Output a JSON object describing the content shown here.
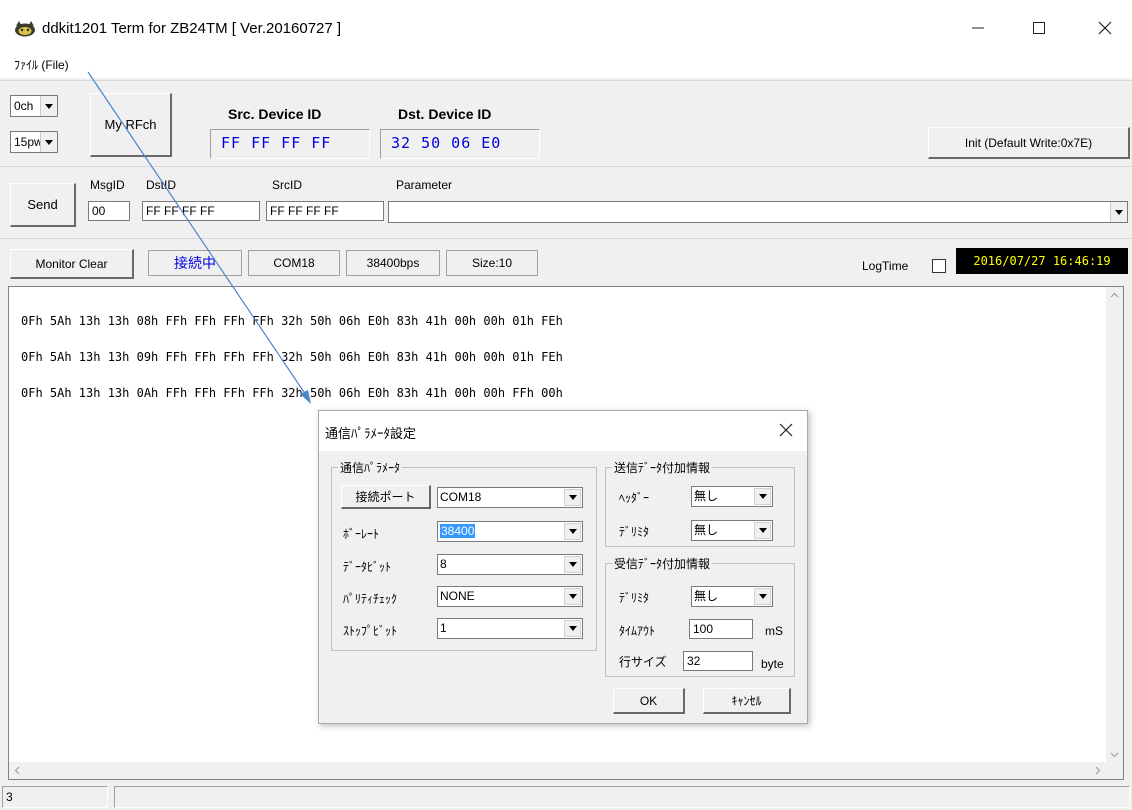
{
  "window": {
    "title": "ddkit1201 Term for ZB24TM  [ Ver.20160727 ]",
    "menu_file": "ﾌｧｲﾙ (File)"
  },
  "top_panel": {
    "channel": "0ch",
    "power": "15pw",
    "my_rfch_label": "My RFch",
    "src_label": "Src. Device ID",
    "dst_label": "Dst. Device ID",
    "src_value": "FF FF FF FF",
    "dst_value": "32 50 06 E0",
    "init_label": "Init (Default Write:0x7E)"
  },
  "send_panel": {
    "send_label": "Send",
    "msgid_label": "MsgID",
    "dstid_label": "DstID",
    "srcid_label": "SrcID",
    "param_label": "Parameter",
    "msgid_value": "00",
    "dstid_value": "FF FF FF FF",
    "srcid_value": "FF FF FF FF",
    "param_value": ""
  },
  "status_panel": {
    "monitor_clear": "Monitor Clear",
    "connected": "接続中",
    "com": "COM18",
    "bps": "38400bps",
    "size": "Size:10",
    "logtime_label": "LogTime",
    "datetime": "2016/07/27 16:46:19"
  },
  "monitor": {
    "lines": [
      "0Fh 5Ah 13h 13h 08h FFh FFh FFh FFh 32h 50h 06h E0h 83h 41h 00h 00h 01h FEh",
      "0Fh 5Ah 13h 13h 09h FFh FFh FFh FFh 32h 50h 06h E0h 83h 41h 00h 00h 01h FEh",
      "0Fh 5Ah 13h 13h 0Ah FFh FFh FFh FFh 32h 50h 06h E0h 83h 41h 00h 00h FFh 00h"
    ]
  },
  "statusbar": {
    "cell1": "3"
  },
  "dialog": {
    "title": "通信ﾊﾟﾗﾒｰﾀ設定",
    "comm_group": "通信ﾊﾟﾗﾒｰﾀ",
    "port_button": "接続ポート",
    "port_value": "COM18",
    "baud_label": "ﾎﾞｰﾚｰﾄ",
    "baud_value": "38400",
    "databit_label": "ﾃﾞｰﾀﾋﾞｯﾄ",
    "databit_value": "8",
    "parity_label": "ﾊﾟﾘﾃｨﾁｪｯｸ",
    "parity_value": "NONE",
    "stopbit_label": "ｽﾄｯﾌﾟﾋﾞｯﾄ",
    "stopbit_value": "1",
    "send_group": "送信ﾃﾞｰﾀ付加情報",
    "header_label": "ﾍｯﾀﾞｰ",
    "header_value": "無し",
    "send_delim_label": "ﾃﾞﾘﾐﾀ",
    "send_delim_value": "無し",
    "recv_group": "受信ﾃﾞｰﾀ付加情報",
    "recv_delim_label": "ﾃﾞﾘﾐﾀ",
    "recv_delim_value": "無し",
    "timeout_label": "ﾀｲﾑｱｳﾄ",
    "timeout_value": "100",
    "timeout_unit": "mS",
    "linesize_label": "行サイズ",
    "linesize_value": "32",
    "linesize_unit": "byte",
    "ok": "OK",
    "cancel": "ｷｬﾝｾﾙ"
  },
  "colors": {
    "accent_blue": "#0000e0",
    "arrow": "#4a86c8",
    "datetime_fg": "#ffff00",
    "datetime_bg": "#000000"
  }
}
